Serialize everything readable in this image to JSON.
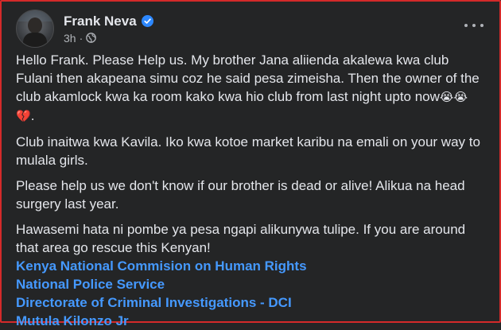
{
  "post": {
    "author": "Frank Neva",
    "time": "3h",
    "dot": "·",
    "verified_icon": "verified-badge-icon",
    "privacy_icon": "globe-icon",
    "more_icon": "more-options-icon",
    "accent_color": "#4599ff",
    "paragraphs": {
      "p1_text": "Hello Frank. Please Help us. My brother Jana aliienda akalewa kwa club Fulani then akapeana simu coz he said pesa zimeisha. Then the owner of the club akamlock kwa ka room kako kwa hio club from last night upto now",
      "p1_emoji": "😭😭 💔",
      "p1_end": ".",
      "p2": "Club inaitwa kwa Kavila. Iko kwa kotoe market karibu na emali on your way to mulala girls.",
      "p3": "Please help us we don't know if our brother is dead or alive! Alikua na head surgery last year.",
      "p4": "Hawasemi hata ni pombe ya pesa ngapi alikunywa tulipe. If you are around that area go rescue this Kenyan!"
    },
    "mentions": [
      "Kenya National Commision on Human Rights",
      "National Police Service",
      "Directorate of Criminal Investigations - DCI",
      "Mutula Kilonzo Jr"
    ]
  }
}
